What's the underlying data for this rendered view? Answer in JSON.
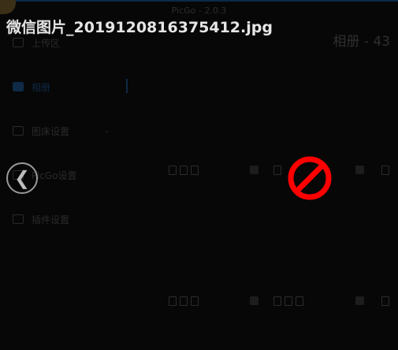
{
  "window": {
    "title": "PicGo - 2.0.3"
  },
  "sidebar": {
    "items": [
      {
        "label": "上传区"
      },
      {
        "label": "相册"
      },
      {
        "label": "图床设置"
      },
      {
        "label": "PicGo设置"
      },
      {
        "label": "插件设置"
      }
    ]
  },
  "gallery": {
    "title": "相册 - 43"
  },
  "viewer": {
    "filename": "微信图片_20191208163754​12.jpg",
    "prev_label": "❮"
  },
  "colors": {
    "accent": "#0f2a46",
    "error": "#ff0000"
  },
  "icons": [
    "prev-icon",
    "blocked-image-icon",
    "file-icon",
    "edit-icon",
    "trash-icon"
  ]
}
